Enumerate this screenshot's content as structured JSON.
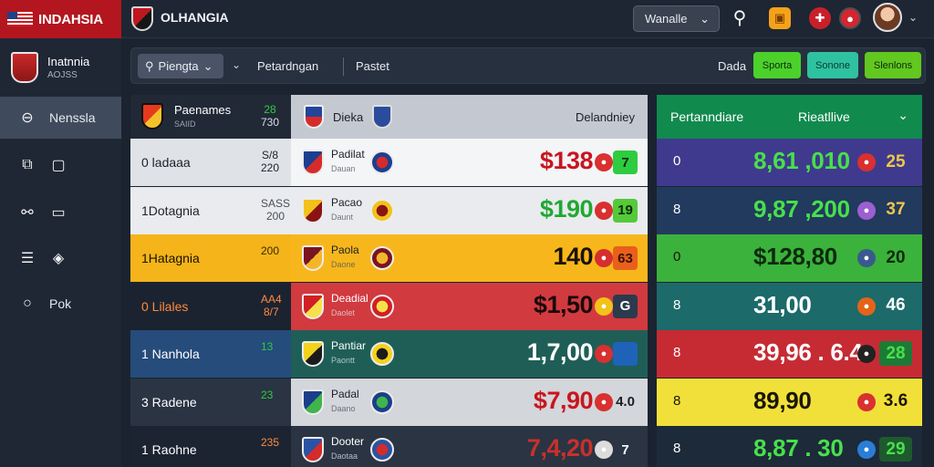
{
  "app": {
    "brand": "INDAHSIA",
    "title": "OLHANGIA",
    "dropdown": "Wanalle",
    "icons": {
      "search": "search-icon",
      "gift": "gift-icon",
      "flag": "flag-icon",
      "alert": "alert-icon"
    }
  },
  "sidebar": {
    "profile_name": "Inatnnia",
    "profile_sub": "AOJSS",
    "items": [
      {
        "label": "Nenssla",
        "icon": "home-icon",
        "active": true
      },
      {
        "label": "",
        "icon": "calendar-icon",
        "active": false
      },
      {
        "label": "",
        "icon": "link-icon",
        "active": false
      },
      {
        "label": "",
        "icon": "card-icon",
        "active": false
      },
      {
        "label": "Pok",
        "icon": "circle-icon",
        "active": false
      }
    ]
  },
  "toolbar": {
    "dropdown": "Piengta",
    "tab1": "Petardngan",
    "tab2": "Pastet",
    "text": "Dada",
    "buttons": [
      "Sporta",
      "Sonone",
      "Slenlons"
    ]
  },
  "table": {
    "header": {
      "name": "Paenames",
      "sub": "SAIID",
      "num_top": "28",
      "num_bottom": "730",
      "team1": "Dieka",
      "team2": "Delandniey"
    },
    "rows": [
      {
        "name": "0 ladaaa",
        "num_top": "S/8",
        "num_bottom": "220",
        "match": "Padilat",
        "match_sub": "Dauan",
        "price": "$138",
        "badge": "7",
        "left_bg": "#dfe2e6",
        "left_color": "#1d2128",
        "right_bg": "#f4f5f7",
        "price_color": "#c9151e",
        "badge_bg": "#2ecc40",
        "badge_color": "#0c2b0c",
        "num_color": "#1d2128",
        "icon_bg": "#d93030"
      },
      {
        "name": "1Dotagnia",
        "num_top": "SASS",
        "num_bottom": "200",
        "match": "Pacao",
        "match_sub": "Daunt",
        "price": "$190",
        "badge": "19",
        "left_bg": "#e9ebee",
        "left_color": "#1d2128",
        "right_bg": "#e9ebee",
        "price_color": "#21a834",
        "badge_bg": "#54c93a",
        "badge_color": "#0c2b0c",
        "num_color": "#4a4f58",
        "icon_bg": "#d93030"
      },
      {
        "name": "1Hatagnia",
        "num_top": "200",
        "num_bottom": "",
        "match": "Paola",
        "match_sub": "Daone",
        "price": "140",
        "badge": "63",
        "left_bg": "#f4b41a",
        "left_color": "#1a1200",
        "right_bg": "#f7b71c",
        "price_color": "#1a1200",
        "badge_bg": "#e8601c",
        "badge_color": "#3b1100",
        "num_color": "#3b2a00",
        "icon_bg": "#d62e2e"
      },
      {
        "name": "0 Lilales",
        "num_top": "AA4",
        "num_bottom": "8/7",
        "match": "Deadial",
        "match_sub": "Daolet",
        "price": "$1,50",
        "badge": "G",
        "left_bg": "#1b2330",
        "left_color": "#ff8a3d",
        "right_bg": "#d13a3f",
        "price_color": "#1a0a0a",
        "badge_bg": "#2b3a4d",
        "badge_color": "#ffffff",
        "num_color": "#ff8a3d",
        "icon_bg": "#f2c21a"
      },
      {
        "name": "1 Nanhola",
        "num_top": "13",
        "num_bottom": "",
        "match": "Pantiar",
        "match_sub": "Paontt",
        "price": "1,7,00",
        "badge": "",
        "left_bg": "#254c7a",
        "left_color": "#ffffff",
        "right_bg": "#1f5e57",
        "price_color": "#ffffff",
        "badge_bg": "#1e63b8",
        "badge_color": "#ffffff",
        "num_color": "#2ecc40",
        "icon_bg": "#d93030"
      },
      {
        "name": "3 Radene",
        "num_top": "23",
        "num_bottom": "",
        "match": "Padal",
        "match_sub": "Daano",
        "price": "$7,90",
        "badge": "4.0",
        "left_bg": "#2a3443",
        "left_color": "#ffffff",
        "right_bg": "#d3d6da",
        "price_color": "#c9151e",
        "badge_bg": "#d3d6da",
        "badge_color": "#1b1f27",
        "num_color": "#2ecc40",
        "icon_bg": "#d93030"
      },
      {
        "name": "1 Raohne",
        "num_top": "235",
        "num_bottom": "",
        "match": "Dooter",
        "match_sub": "Daotaa",
        "price": "7,4,20",
        "badge": "7",
        "left_bg": "#1c2431",
        "left_color": "#ffffff",
        "right_bg": "#2a3443",
        "price_color": "#c9302c",
        "badge_bg": "#2a3443",
        "badge_color": "#ffffff",
        "num_color": "#ff8a3d",
        "icon_bg": "#dcdcdc"
      }
    ]
  },
  "panel": {
    "title": "Pertanndiare",
    "title2": "Rieatllive",
    "rows": [
      {
        "idx": "0",
        "value": "8,61 ,010",
        "badge": "25",
        "bg": "#3f3a8e",
        "value_color": "#48e04a",
        "badge_bg": "#3f3a8e",
        "badge_color": "#f0c64a",
        "icon_bg": "#d93030"
      },
      {
        "idx": "8",
        "value": "9,87 ,200",
        "badge": "37",
        "bg": "#213a5e",
        "value_color": "#48e04a",
        "badge_bg": "#213a5e",
        "badge_color": "#f0c64a",
        "icon_bg": "#9c5fd1"
      },
      {
        "idx": "0",
        "value": "$128,80",
        "badge": "20",
        "bg": "#3bb23b",
        "value_color": "#0d2a0d",
        "badge_bg": "#3bb23b",
        "badge_color": "#0d2a0d",
        "icon_bg": "#3a5a8e"
      },
      {
        "idx": "8",
        "value": "31,00",
        "badge": "46",
        "bg": "#1d6a6a",
        "value_color": "#ffffff",
        "badge_bg": "#1d6a6a",
        "badge_color": "#ffffff",
        "icon_bg": "#e2641a"
      },
      {
        "idx": "8",
        "value": "39,96 . 6.4",
        "badge": "28",
        "bg": "#c62b34",
        "value_color": "#ffffff",
        "badge_bg": "#1d7a36",
        "badge_color": "#48e04a",
        "icon_bg": "#222222"
      },
      {
        "idx": "8",
        "value": "89,90",
        "badge": "3.6",
        "bg": "#f2e03a",
        "value_color": "#1a1600",
        "badge_bg": "#f2e03a",
        "badge_color": "#1a1600",
        "icon_bg": "#d93030"
      },
      {
        "idx": "8",
        "value": "8,87 . 30",
        "badge": "29",
        "bg": "#1d2a3a",
        "value_color": "#48e04a",
        "badge_bg": "#1d5a2e",
        "badge_color": "#48e04a",
        "icon_bg": "#2a7dd6"
      }
    ]
  }
}
